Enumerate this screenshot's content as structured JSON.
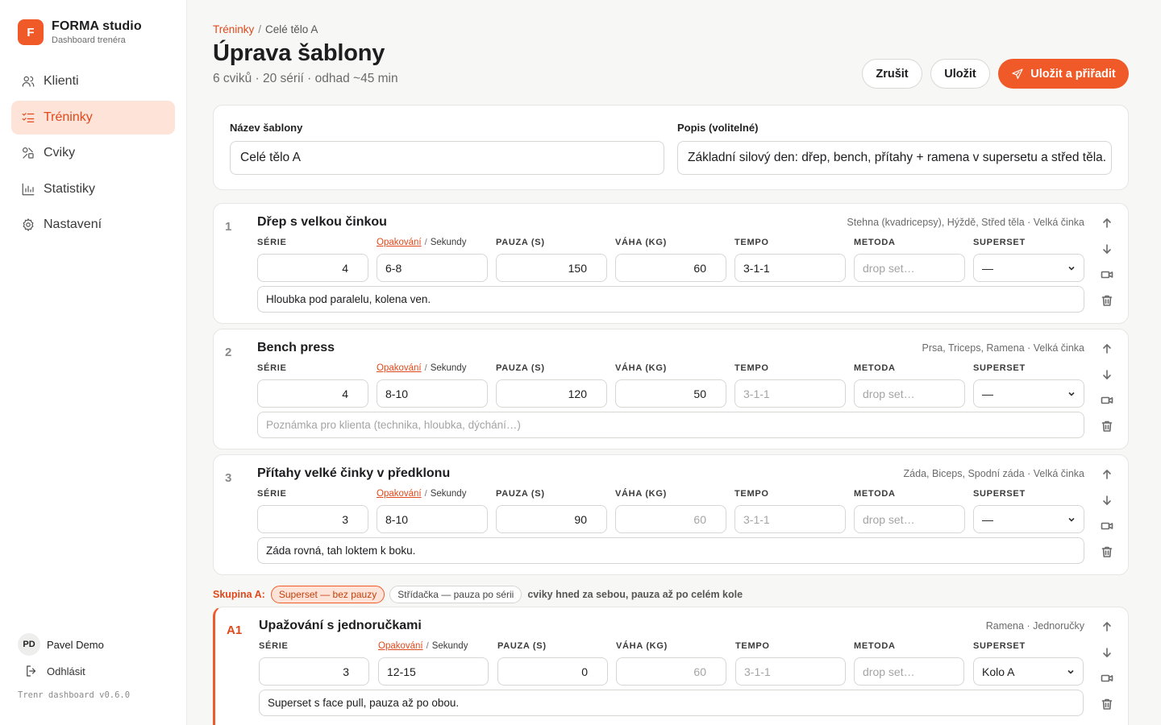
{
  "brand": {
    "logo_letter": "F",
    "title": "FORMA studio",
    "subtitle": "Dashboard trenéra",
    "accent": "#f05a28"
  },
  "nav": [
    {
      "label": "Klienti",
      "icon": "users-icon",
      "active": false
    },
    {
      "label": "Tréninky",
      "icon": "checklist-icon",
      "active": true
    },
    {
      "label": "Cviky",
      "icon": "shapes-icon",
      "active": false
    },
    {
      "label": "Statistiky",
      "icon": "bar-chart-icon",
      "active": false
    },
    {
      "label": "Nastavení",
      "icon": "gear-icon",
      "active": false
    }
  ],
  "user": {
    "initials": "PD",
    "name": "Pavel Demo",
    "logout_label": "Odhlásit"
  },
  "version": "Trenr dashboard v0.6.0",
  "breadcrumb": {
    "parent": "Tréninky",
    "separator": "/",
    "current": "Celé tělo A"
  },
  "page": {
    "title": "Úprava šablony",
    "subtitle": "6 cviků · 20 sérií · odhad ~45 min"
  },
  "actions": {
    "cancel": "Zrušit",
    "save": "Uložit",
    "save_assign": "Uložit a přiřadit"
  },
  "template_form": {
    "name_label": "Název šablony",
    "name_value": "Celé tělo A",
    "desc_label": "Popis (volitelné)",
    "desc_value": "Základní silový den: dřep, bench, přítahy + ramena v supersetu a střed těla."
  },
  "columns": {
    "series": "SÉRIE",
    "reps_active": "Opakování",
    "reps_sep": "/",
    "reps_other": "Sekundy",
    "pause": "PAUZA (S)",
    "weight": "VÁHA (KG)",
    "tempo": "TEMPO",
    "method": "METODA",
    "superset": "SUPERSET"
  },
  "exercises": [
    {
      "num": "1",
      "name": "Dřep s velkou činkou",
      "meta": "Stehna (kvadricepsy), Hýždě, Střed těla · Velká činka",
      "series": "4",
      "reps": "6-8",
      "pause": "150",
      "weight": "60",
      "tempo": "3-1-1",
      "method": "drop set…",
      "superset": "—",
      "note": "Hloubka pod paralelu, kolena ven."
    },
    {
      "num": "2",
      "name": "Bench press",
      "meta": "Prsa, Triceps, Ramena · Velká činka",
      "series": "4",
      "reps": "8-10",
      "pause": "120",
      "weight": "50",
      "tempo": "3-1-1",
      "method": "drop set…",
      "superset": "—",
      "note": "Poznámka pro klienta (technika, hloubka, dýchání…)"
    },
    {
      "num": "3",
      "name": "Přítahy velké činky v předklonu",
      "meta": "Záda, Biceps, Spodní záda · Velká činka",
      "series": "3",
      "reps": "8-10",
      "pause": "90",
      "weight": "60",
      "tempo": "3-1-1",
      "method": "drop set…",
      "superset": "—",
      "note": "Záda rovná, tah loktem k boku."
    },
    {
      "num": "A1",
      "name": "Upažování s jednoručkami",
      "meta": "Ramena · Jednoručky",
      "series": "3",
      "reps": "12-15",
      "pause": "0",
      "weight": "60",
      "tempo": "3-1-1",
      "method": "drop set…",
      "superset": "Kolo A",
      "note": "Superset s face pull, pauza až po obou."
    }
  ],
  "group": {
    "label": "Skupina A:",
    "option_active": "Superset — bez pauzy",
    "option_other": "Střídačka — pauza po sérii",
    "description": "cviky hned za sebou, pauza až po celém kole"
  }
}
